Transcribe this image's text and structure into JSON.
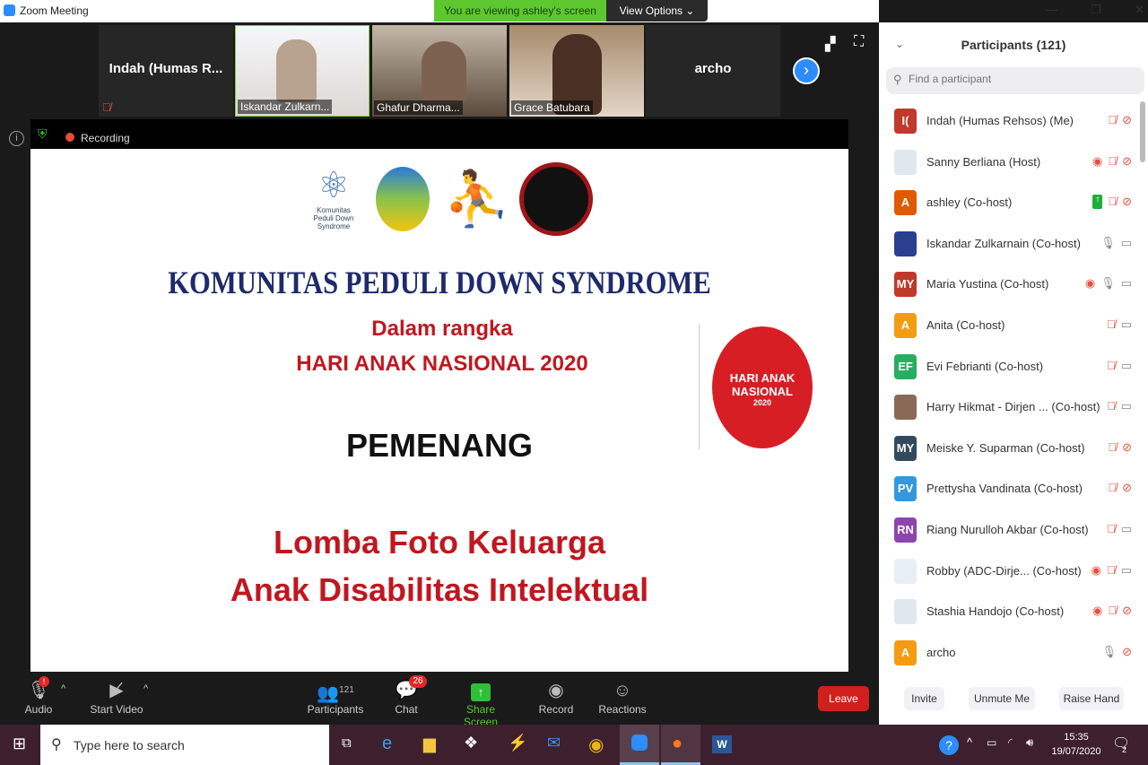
{
  "window": {
    "title": "Zoom Meeting",
    "viewing_banner": "You are viewing ashley's screen",
    "view_options": "View Options ⌄",
    "controls": [
      "—",
      "❐",
      "✕"
    ]
  },
  "gallery": {
    "tiles": [
      {
        "name": "Indah (Humas R...",
        "video": false
      },
      {
        "name": "Iskandar Zulkarn...",
        "video": true
      },
      {
        "name": "Ghafur Dharma...",
        "video": true
      },
      {
        "name": "Grace Batubara",
        "video": true
      },
      {
        "name": "archo",
        "video": false
      }
    ]
  },
  "share": {
    "recording": "Recording"
  },
  "slide": {
    "org": "KOMUNITAS PEDULI DOWN SYNDROME",
    "line1": "Dalam rangka",
    "line2": "HARI ANAK NASIONAL 2020",
    "winner": "PEMENANG",
    "contest1": "Lomba Foto Keluarga",
    "contest2": "Anak Disabilitas Intelektual",
    "logo_han": "HARI ANAK NASIONAL",
    "logo_han_year": "2020",
    "logo_kpds": "Komunitas Peduli Down Syndrome"
  },
  "toolbar": {
    "audio": "Audio",
    "audio_badge": "!",
    "video": "Start Video",
    "participants": "Participants",
    "participants_count": "121",
    "chat": "Chat",
    "chat_badge": "26",
    "share": "Share Screen",
    "record": "Record",
    "reactions": "Reactions",
    "leave": "Leave",
    "accent": "#5cc72f"
  },
  "panel": {
    "title": "Participants (121)",
    "search_placeholder": "Find a participant",
    "invite": "Invite",
    "unmute": "Unmute Me",
    "raise": "Raise Hand",
    "participants": [
      {
        "initials": "I(",
        "name": "Indah (Humas Rehsos) (Me)",
        "color": "#c0392b",
        "rec": false,
        "share": false,
        "mic": "muted",
        "cam": "off"
      },
      {
        "initials": "",
        "name": "Sanny Berliana (Host)",
        "color": "#dfe8ee",
        "rec": true,
        "share": false,
        "mic": "muted",
        "cam": "off"
      },
      {
        "initials": "A",
        "name": "ashley (Co-host)",
        "color": "#e05a00",
        "rec": false,
        "share": true,
        "mic": "muted",
        "cam": "off"
      },
      {
        "initials": "",
        "name": "Iskandar Zulkarnain (Co-host)",
        "color": "#2b3f8f",
        "rec": false,
        "share": false,
        "mic": "on",
        "cam": "on"
      },
      {
        "initials": "MY",
        "name": "Maria Yustina (Co-host)",
        "color": "#c0392b",
        "rec": true,
        "share": false,
        "mic": "on",
        "cam": "on"
      },
      {
        "initials": "A",
        "name": "Anita (Co-host)",
        "color": "#f39c12",
        "rec": false,
        "share": false,
        "mic": "muted",
        "cam": "on"
      },
      {
        "initials": "EF",
        "name": "Evi Febrianti (Co-host)",
        "color": "#27ae60",
        "rec": false,
        "share": false,
        "mic": "muted",
        "cam": "on"
      },
      {
        "initials": "",
        "name": "Harry Hikmat - Dirjen ... (Co-host)",
        "color": "#8a6a55",
        "rec": false,
        "share": false,
        "mic": "muted",
        "cam": "on"
      },
      {
        "initials": "MY",
        "name": "Meiske Y. Suparman (Co-host)",
        "color": "#34495e",
        "rec": false,
        "share": false,
        "mic": "muted",
        "cam": "off"
      },
      {
        "initials": "PV",
        "name": "Prettysha Vandinata (Co-host)",
        "color": "#3498db",
        "rec": false,
        "share": false,
        "mic": "muted",
        "cam": "off"
      },
      {
        "initials": "RN",
        "name": "Riang Nurulloh Akbar (Co-host)",
        "color": "#8e44ad",
        "rec": false,
        "share": false,
        "mic": "muted",
        "cam": "on"
      },
      {
        "initials": "",
        "name": "Robby (ADC-Dirje... (Co-host)",
        "color": "#e8eef5",
        "rec": true,
        "share": false,
        "mic": "muted",
        "cam": "on"
      },
      {
        "initials": "",
        "name": "Stashia Handojo (Co-host)",
        "color": "#dfe8ee",
        "rec": true,
        "share": false,
        "mic": "muted",
        "cam": "off"
      },
      {
        "initials": "A",
        "name": "archo",
        "color": "#f39c12",
        "rec": false,
        "share": false,
        "mic": "on",
        "cam": "off"
      }
    ]
  },
  "taskbar": {
    "search_placeholder": "Type here to search",
    "time": "15:35",
    "date": "19/07/2020",
    "notif_count": "2"
  }
}
